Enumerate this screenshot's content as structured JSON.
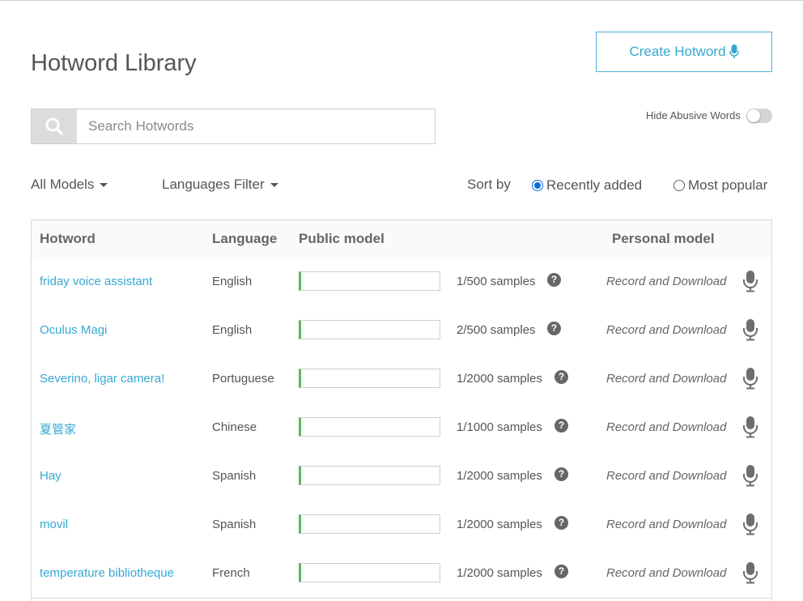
{
  "page": {
    "title": "Hotword Library"
  },
  "header": {
    "create_button_label": "Create Hotword"
  },
  "search": {
    "placeholder": "Search Hotwords"
  },
  "toggle": {
    "label": "Hide Abusive Words",
    "on": false
  },
  "filters": {
    "models": "All Models",
    "languages": "Languages Filter"
  },
  "sort": {
    "label": "Sort by",
    "options": [
      "Recently added",
      "Most popular"
    ],
    "selected": "Recently added"
  },
  "table": {
    "headers": {
      "hotword": "Hotword",
      "language": "Language",
      "public_model": "Public model",
      "personal_model": "Personal model"
    },
    "rows": [
      {
        "hotword": "friday voice assistant",
        "language": "English",
        "samples": "1/500 samples",
        "progress": 0.002,
        "action": "Record and Download"
      },
      {
        "hotword": "Oculus Magi",
        "language": "English",
        "samples": "2/500 samples",
        "progress": 0.004,
        "action": "Record and Download"
      },
      {
        "hotword": "Severino, ligar camera!",
        "language": "Portuguese",
        "samples": "1/2000 samples",
        "progress": 0.0005,
        "action": "Record and Download"
      },
      {
        "hotword": "夏管家",
        "language": "Chinese",
        "samples": "1/1000 samples",
        "progress": 0.001,
        "action": "Record and Download"
      },
      {
        "hotword": "Hay",
        "language": "Spanish",
        "samples": "1/2000 samples",
        "progress": 0.0005,
        "action": "Record and Download"
      },
      {
        "hotword": "movil",
        "language": "Spanish",
        "samples": "1/2000 samples",
        "progress": 0.0005,
        "action": "Record and Download"
      },
      {
        "hotword": "temperature bibliotheque",
        "language": "French",
        "samples": "1/2000 samples",
        "progress": 0.0005,
        "action": "Record and Download"
      }
    ]
  },
  "colors": {
    "accent": "#35a9d0",
    "progress": "#5cb85c",
    "radio": "#0a6ed8"
  }
}
